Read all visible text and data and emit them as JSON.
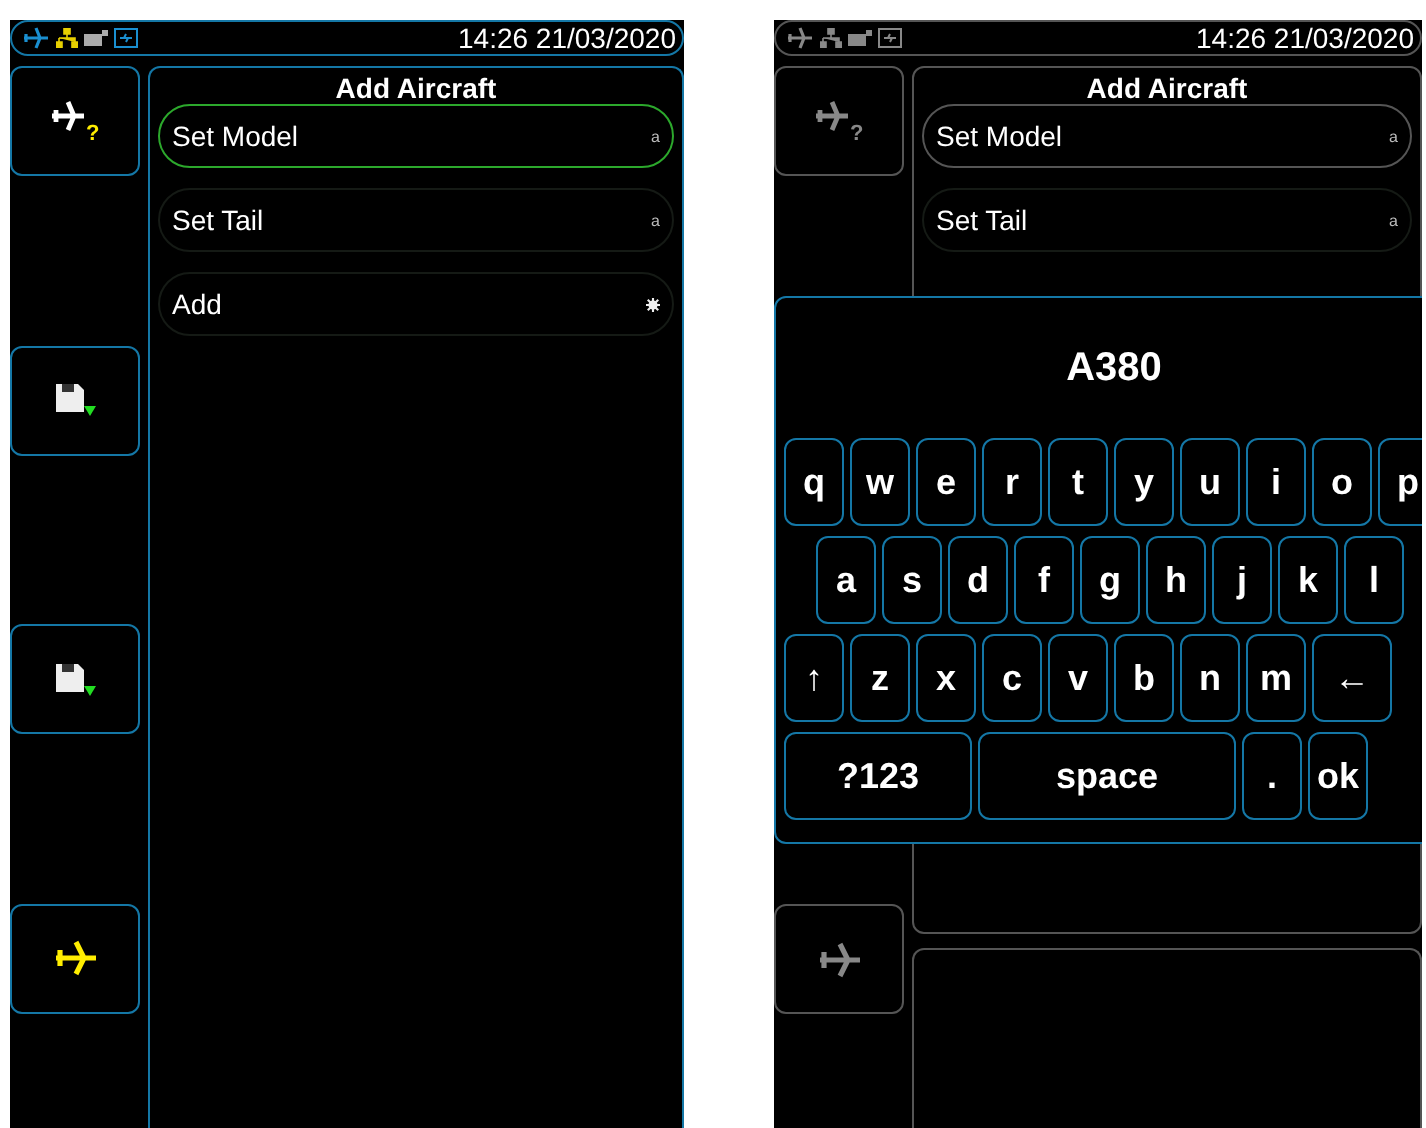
{
  "screens": [
    {
      "dimmed": false,
      "status_bar": {
        "time": "14:26 21/03/2020"
      },
      "side_buttons": [
        {
          "kind": "plane-question",
          "badge": "?"
        },
        {
          "kind": "save"
        },
        {
          "kind": "save"
        },
        {
          "kind": "plane"
        }
      ],
      "panel": {
        "title": "Add Aircraft",
        "items": [
          {
            "label": "Set Model",
            "kind": "text",
            "indicator": "a",
            "selected": true
          },
          {
            "label": "Set Tail",
            "kind": "text",
            "indicator": "a",
            "selected": false
          },
          {
            "label": "Add",
            "kind": "action",
            "selected": false
          }
        ]
      },
      "lower_panel": false
    },
    {
      "dimmed": true,
      "status_bar": {
        "time": "14:26 21/03/2020"
      },
      "side_buttons": [
        {
          "kind": "plane-question",
          "badge": "?"
        },
        {
          "kind": "plane"
        }
      ],
      "panel": {
        "title": "Add Aircraft",
        "items": [
          {
            "label": "Set Model",
            "kind": "text",
            "indicator": "a",
            "selected": true
          },
          {
            "label": "Set Tail",
            "kind": "text",
            "indicator": "a",
            "selected": false
          }
        ]
      },
      "lower_panel": true,
      "keyboard": {
        "value": "A380",
        "rows": [
          {
            "keys": [
              "q",
              "w",
              "e",
              "r",
              "t",
              "y",
              "u",
              "i",
              "o",
              "p"
            ]
          },
          {
            "keys": [
              "a",
              "s",
              "d",
              "f",
              "g",
              "h",
              "j",
              "k",
              "l"
            ]
          },
          {
            "keys": [
              "↑",
              "z",
              "x",
              "c",
              "v",
              "b",
              "n",
              "m",
              "←"
            ]
          },
          {
            "keys": [
              "?123",
              "space",
              ".",
              "ok"
            ]
          }
        ]
      }
    }
  ]
}
